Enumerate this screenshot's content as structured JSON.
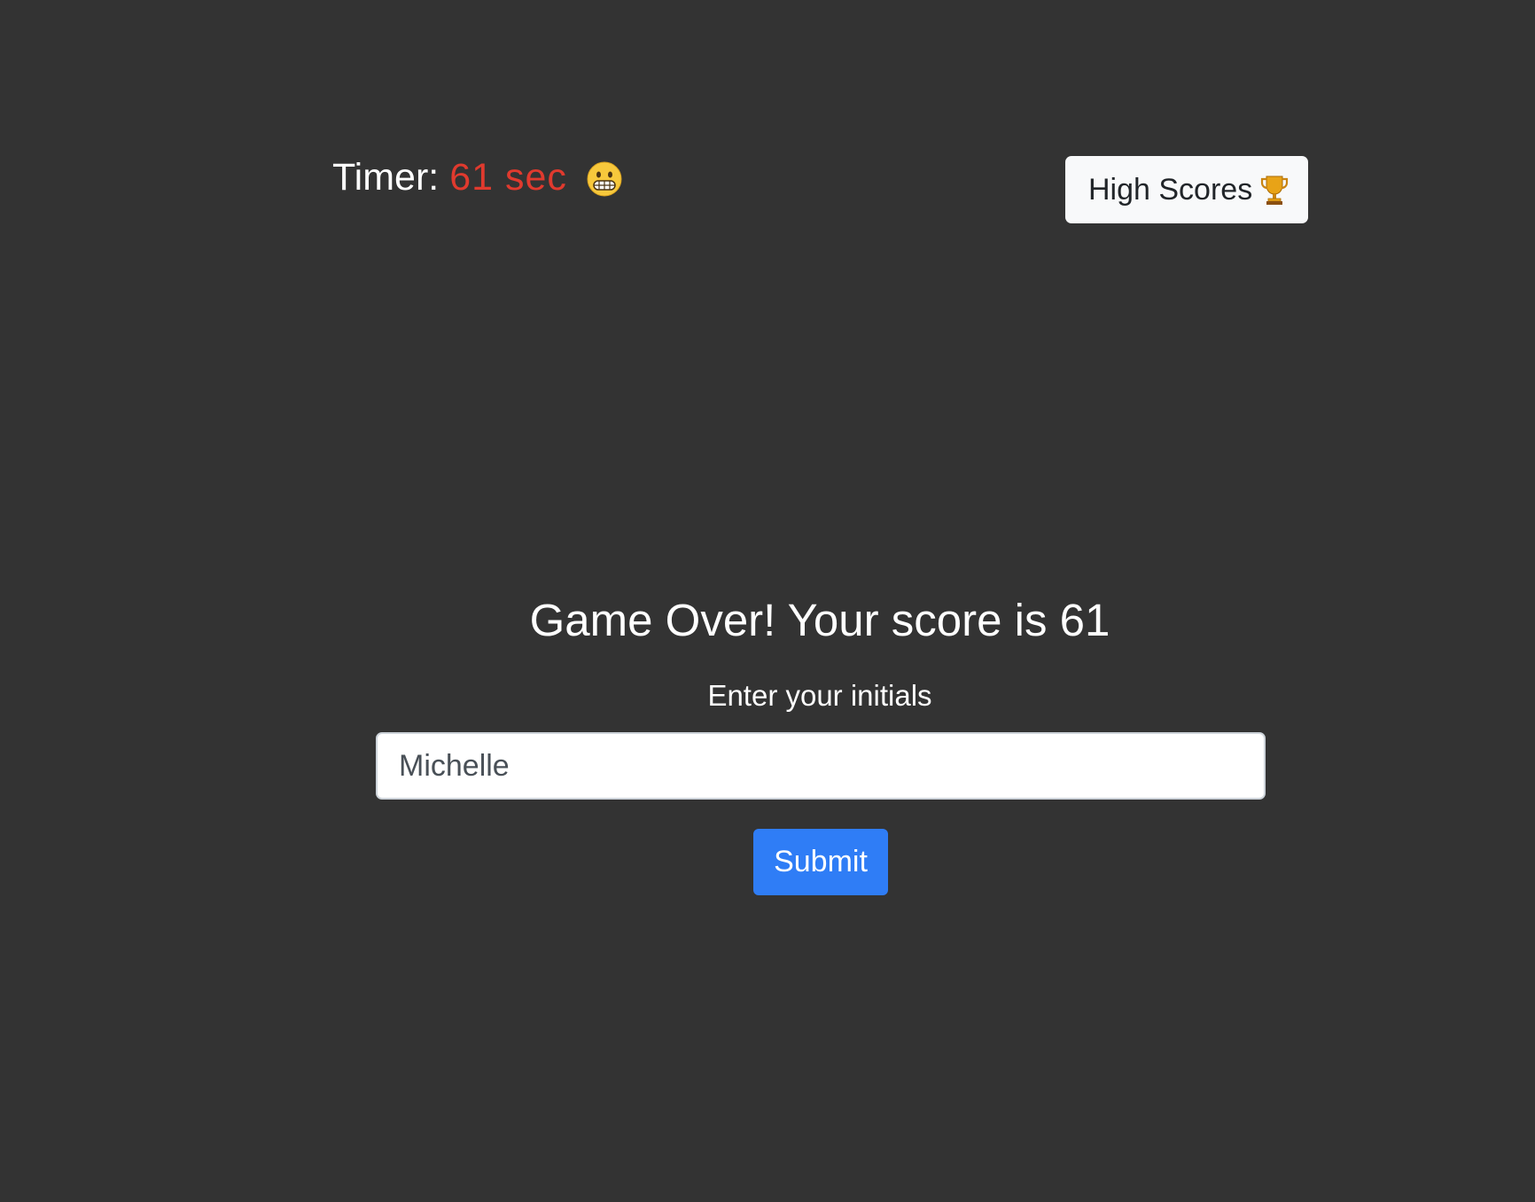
{
  "header": {
    "timer_label": "Timer:",
    "timer_value": "61 sec",
    "timer_icon": "grimacing-face-icon",
    "high_scores_label": "High Scores",
    "high_scores_icon": "trophy-icon"
  },
  "game_over": {
    "message": "Game Over! Your score is 61",
    "initials_label": "Enter your initials",
    "initials_value": "Michelle",
    "submit_label": "Submit"
  },
  "colors": {
    "background": "#333333",
    "timer_value": "#e03a2e",
    "submit_button": "#2f7df6",
    "high_scores_button": "#f8f9fa"
  }
}
